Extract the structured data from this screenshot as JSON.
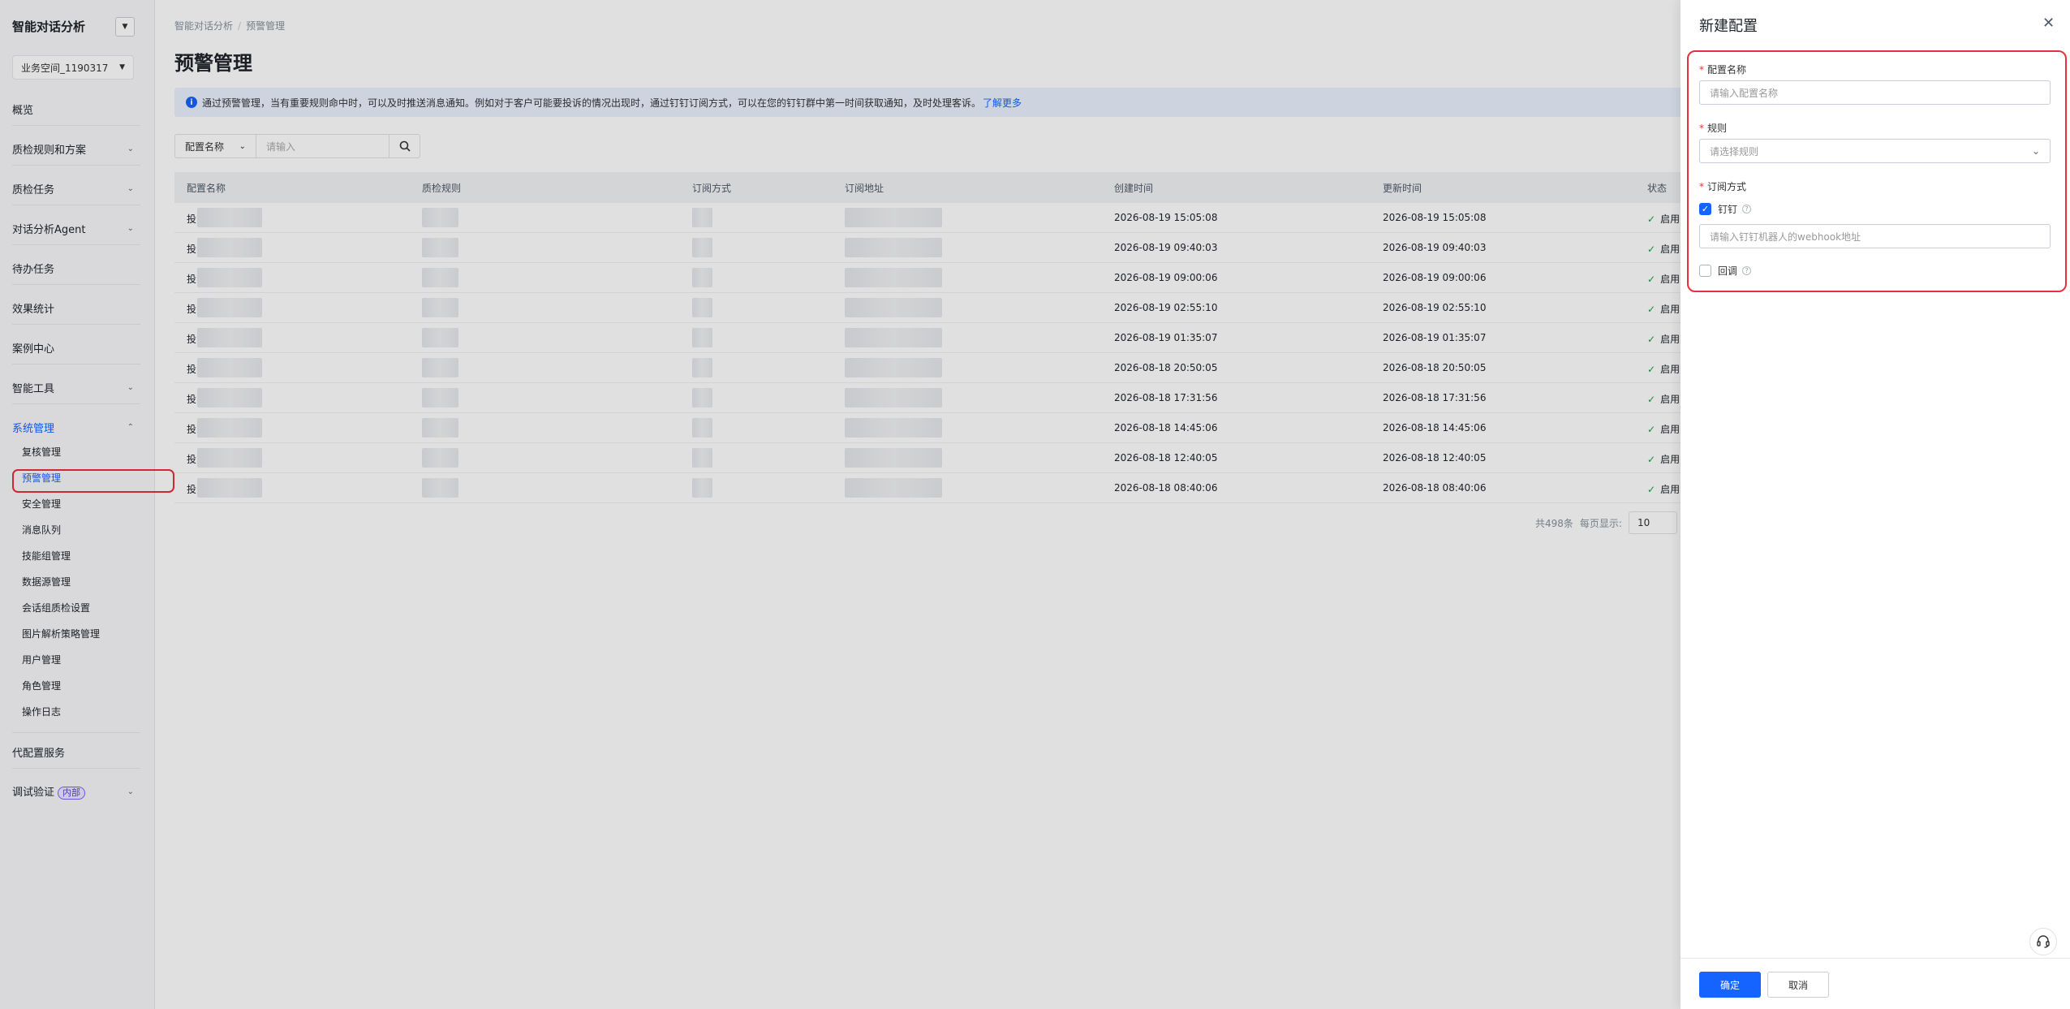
{
  "sidebar": {
    "app_title": "智能对话分析",
    "workspace": "业务空间_1190317",
    "nav": [
      {
        "label": "概览"
      },
      {
        "label": "质检规则和方案"
      },
      {
        "label": "质检任务"
      },
      {
        "label": "对话分析Agent"
      },
      {
        "label": "待办任务"
      },
      {
        "label": "效果统计"
      },
      {
        "label": "案例中心"
      },
      {
        "label": "智能工具"
      },
      {
        "label": "系统管理"
      },
      {
        "label": "代配置服务"
      },
      {
        "label": "调试验证"
      }
    ],
    "badge": "内部",
    "sub_items": [
      {
        "label": "复核管理"
      },
      {
        "label": "预警管理"
      },
      {
        "label": "安全管理"
      },
      {
        "label": "消息队列"
      },
      {
        "label": "技能组管理"
      },
      {
        "label": "数据源管理"
      },
      {
        "label": "会话组质检设置"
      },
      {
        "label": "图片解析策略管理"
      },
      {
        "label": "用户管理"
      },
      {
        "label": "角色管理"
      },
      {
        "label": "操作日志"
      }
    ]
  },
  "main": {
    "breadcrumb": [
      "智能对话分析",
      "预警管理"
    ],
    "title": "预警管理",
    "notice": "通过预警管理，当有重要规则命中时，可以及时推送消息通知。例如对于客户可能要投诉的情况出现时，通过钉钉订阅方式，可以在您的钉钉群中第一时间获取通知，及时处理客诉。",
    "notice_link": "了解更多",
    "filter": {
      "field": "配置名称",
      "placeholder": "请输入"
    },
    "columns": [
      "配置名称",
      "质检规则",
      "订阅方式",
      "订阅地址",
      "创建时间",
      "更新时间",
      "状态"
    ],
    "rows": [
      {
        "name": "投",
        "created": "2026-08-19 15:05:08",
        "updated": "2026-08-19 15:05:08",
        "status": "启用"
      },
      {
        "name": "投",
        "created": "2026-08-19 09:40:03",
        "updated": "2026-08-19 09:40:03",
        "status": "启用"
      },
      {
        "name": "投",
        "created": "2026-08-19 09:00:06",
        "updated": "2026-08-19 09:00:06",
        "status": "启用"
      },
      {
        "name": "投",
        "created": "2026-08-19 02:55:10",
        "updated": "2026-08-19 02:55:10",
        "status": "启用"
      },
      {
        "name": "投",
        "created": "2026-08-19 01:35:07",
        "updated": "2026-08-19 01:35:07",
        "status": "启用"
      },
      {
        "name": "投",
        "created": "2026-08-18 20:50:05",
        "updated": "2026-08-18 20:50:05",
        "status": "启用"
      },
      {
        "name": "投",
        "created": "2026-08-18 17:31:56",
        "updated": "2026-08-18 17:31:56",
        "status": "启用"
      },
      {
        "name": "投",
        "created": "2026-08-18 14:45:06",
        "updated": "2026-08-18 14:45:06",
        "status": "启用"
      },
      {
        "name": "投",
        "created": "2026-08-18 12:40:05",
        "updated": "2026-08-18 12:40:05",
        "status": "启用"
      },
      {
        "name": "投",
        "created": "2026-08-18 08:40:06",
        "updated": "2026-08-18 08:40:06",
        "status": "启用"
      }
    ],
    "pagination": {
      "total": "共498条",
      "per_page_label": "每页显示:",
      "per_page": "10"
    }
  },
  "drawer": {
    "title": "新建配置",
    "name_label": "配置名称",
    "name_placeholder": "请输入配置名称",
    "rule_label": "规则",
    "rule_placeholder": "请选择规则",
    "subscribe_label": "订阅方式",
    "dingtalk_label": "钉钉",
    "dingtalk_checked": true,
    "webhook_placeholder": "请输入钉钉机器人的webhook地址",
    "callback_label": "回调",
    "callback_checked": false,
    "confirm": "确定",
    "cancel": "取消"
  }
}
